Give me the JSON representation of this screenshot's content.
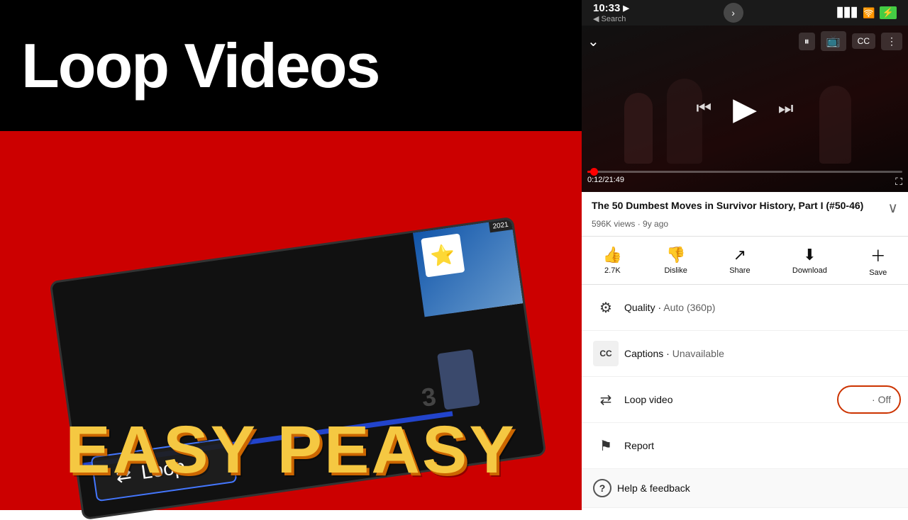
{
  "left": {
    "title": "Loop Videos",
    "easy_peasy": "EASY PEASY",
    "loop_label": "Loop"
  },
  "right": {
    "status_bar": {
      "time": "10:33",
      "location_icon": "▶",
      "search_label": "◀ Search",
      "nav_next": "›",
      "signal": "📶",
      "wifi": "WiFi",
      "battery": "🔋"
    },
    "player": {
      "time_current": "0:12",
      "time_total": "21:49"
    },
    "video": {
      "title": "The 50 Dumbest Moves in Survivor History, Part I (#50-46)",
      "views": "596K views · 9y ago"
    },
    "actions": [
      {
        "icon": "👍",
        "label": "2.7K",
        "name": "like"
      },
      {
        "icon": "👎",
        "label": "Dislike",
        "name": "dislike"
      },
      {
        "icon": "↗",
        "label": "Share",
        "name": "share"
      },
      {
        "icon": "⬇",
        "label": "Download",
        "name": "download"
      },
      {
        "icon": "＋",
        "label": "Save",
        "name": "save"
      }
    ],
    "menu": [
      {
        "icon": "⚙",
        "label": "Quality",
        "value": "Auto (360p)",
        "name": "quality"
      },
      {
        "icon": "CC",
        "label": "Captions",
        "value": "Unavailable",
        "name": "captions"
      },
      {
        "icon": "↩",
        "label": "Loop video",
        "value": "Off",
        "name": "loop-video"
      },
      {
        "icon": "⚑",
        "label": "Report",
        "value": "",
        "name": "report"
      },
      {
        "icon": "?",
        "label": "Help & feedback",
        "value": "",
        "name": "help-feedback"
      }
    ]
  }
}
